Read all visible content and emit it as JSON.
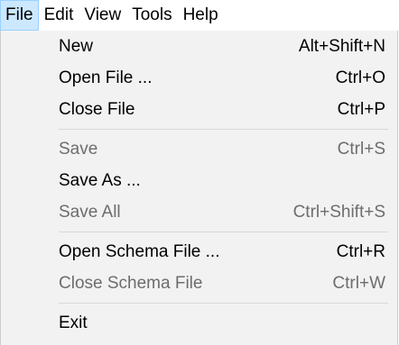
{
  "menubar": {
    "items": [
      "File",
      "Edit",
      "View",
      "Tools",
      "Help"
    ],
    "active": "File"
  },
  "file_menu": {
    "new": {
      "label": "New",
      "shortcut": "Alt+Shift+N"
    },
    "open_file": {
      "label": "Open File ...",
      "shortcut": "Ctrl+O"
    },
    "close_file": {
      "label": "Close File",
      "shortcut": "Ctrl+P"
    },
    "save": {
      "label": "Save",
      "shortcut": "Ctrl+S"
    },
    "save_as": {
      "label": "Save As ...",
      "shortcut": ""
    },
    "save_all": {
      "label": "Save All",
      "shortcut": "Ctrl+Shift+S"
    },
    "open_schema_file": {
      "label": "Open Schema File ...",
      "shortcut": "Ctrl+R"
    },
    "close_schema_file": {
      "label": "Close Schema File",
      "shortcut": "Ctrl+W"
    },
    "exit": {
      "label": "Exit",
      "shortcut": ""
    }
  },
  "colors": {
    "menu_background": "#f2f2f2",
    "active_highlight": "#cce8ff",
    "disabled_text": "#6d6d6d"
  }
}
